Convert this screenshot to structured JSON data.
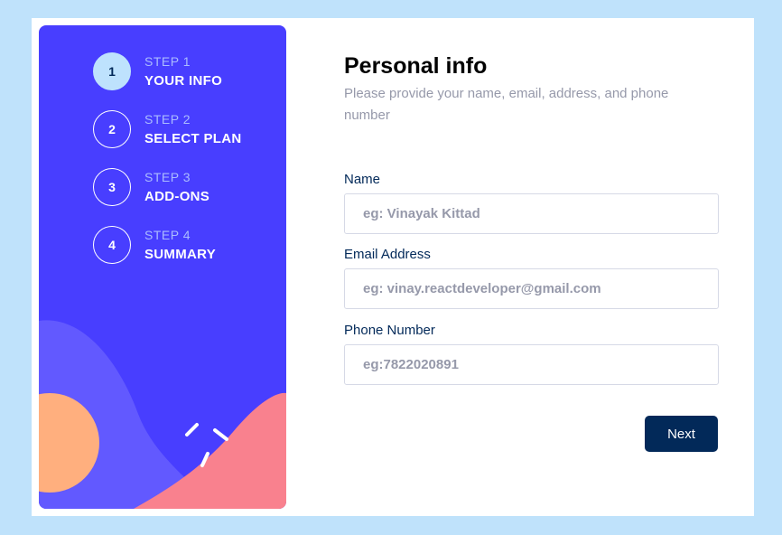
{
  "colors": {
    "page_background": "#bfe2fb",
    "sidebar": "#483eff",
    "active_step": "#bee2fd",
    "primary_button": "#022959",
    "label_text": "#022959",
    "muted_text": "#9699aa",
    "art_purple": "#6259ff",
    "art_orange": "#ffaf7e",
    "art_pink": "#f9818e"
  },
  "sidebar": {
    "steps": [
      {
        "number": "1",
        "label": "STEP 1",
        "title": "YOUR INFO",
        "active": true
      },
      {
        "number": "2",
        "label": "STEP 2",
        "title": "SELECT PLAN",
        "active": false
      },
      {
        "number": "3",
        "label": "STEP 3",
        "title": "ADD-ONS",
        "active": false
      },
      {
        "number": "4",
        "label": "STEP 4",
        "title": "SUMMARY",
        "active": false
      }
    ]
  },
  "form": {
    "title": "Personal info",
    "subtitle": "Please provide your name, email, address, and phone number",
    "fields": [
      {
        "label": "Name",
        "placeholder": "eg: Vinayak Kittad",
        "value": ""
      },
      {
        "label": "Email Address",
        "placeholder": "eg: vinay.reactdeveloper@gmail.com",
        "value": ""
      },
      {
        "label": "Phone Number",
        "placeholder": "eg:7822020891",
        "value": ""
      }
    ],
    "next_label": "Next"
  }
}
